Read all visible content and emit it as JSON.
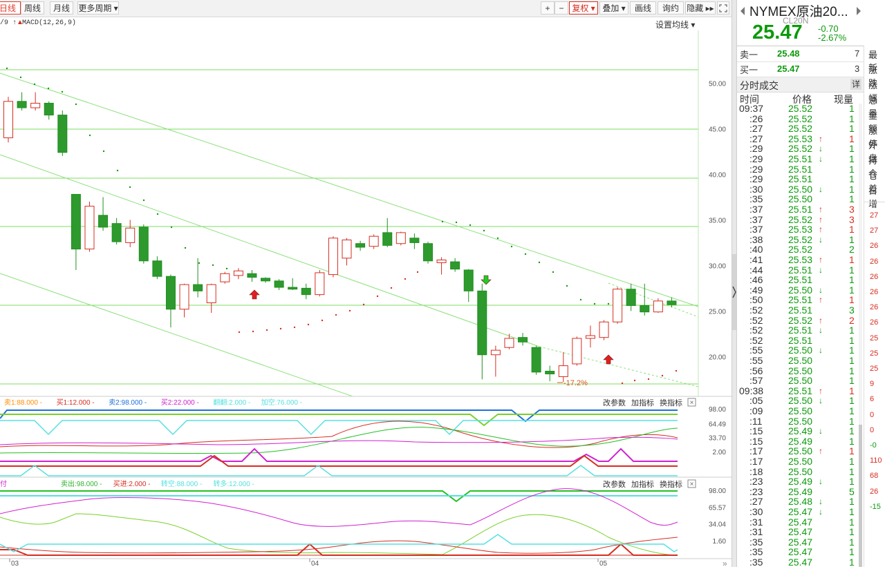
{
  "toolbar": {
    "tabs_left": [
      "日线",
      "周线",
      "月线",
      "更多周期 ▾"
    ],
    "tabs_right": [
      "+",
      "−",
      "复权 ▾",
      "叠加 ▾",
      "画线",
      "询约",
      "隐藏 ▸▸"
    ],
    "fullscreen_icon": "expand-icon"
  },
  "indicator_line": {
    "left": "/9 ↑ ",
    "macd": "MACD(12,26,9)",
    "setting": "设置均线 ▾"
  },
  "price_axis": [
    "50.00",
    "45.00",
    "40.00",
    "35.00",
    "30.00",
    "25.00",
    "20.00"
  ],
  "annotation": "-17.2%",
  "sub1": {
    "legend": [
      {
        "text": "卖1:88.000",
        "color": "#ff8c00"
      },
      {
        "text": "买1:12.000",
        "color": "#d62d20"
      },
      {
        "text": "卖2:98.000",
        "color": "#1e6fd9"
      },
      {
        "text": "买2:22.000",
        "color": "#d020d0"
      },
      {
        "text": "翻翻:2.000",
        "color": "#55e0e0"
      },
      {
        "text": "加空:76.000",
        "color": "#55e0e0"
      }
    ],
    "actions": [
      "改参数",
      "加指标",
      "换指标"
    ],
    "axis": [
      "98.00",
      "64.49",
      "33.70",
      "2.00"
    ]
  },
  "sub2": {
    "legend": [
      {
        "text": "卖出:98.000",
        "color": "#2db52d"
      },
      {
        "text": "买进:2.000",
        "color": "#d62d20"
      },
      {
        "text": "转空:88.000",
        "color": "#55e0e0"
      },
      {
        "text": "转多:12.000",
        "color": "#55e0e0"
      }
    ],
    "actions": [
      "改参数",
      "加指标",
      "换指标"
    ],
    "axis": [
      "98.00",
      "65.57",
      "34.04",
      "1.60"
    ]
  },
  "date_axis": [
    "03",
    "04",
    "05"
  ],
  "quote": {
    "name": "NYMEX原油20...",
    "code": "CL20N",
    "price": "25.47",
    "change": "-0.70",
    "change_pct": "-2.67%",
    "sell1_label": "卖一",
    "sell1_price": "25.48",
    "sell1_vol": "7",
    "buy1_label": "买一",
    "buy1_price": "25.47",
    "buy1_vol": "3"
  },
  "side_labels": [
    "最新",
    "涨跌",
    "涨幅",
    "总量",
    "金额",
    "涨停",
    "外盘",
    "持仓",
    "仓差",
    "日增"
  ],
  "side_values": [
    "27",
    "27",
    "26",
    "26",
    "26",
    "26",
    "26",
    "26",
    "25",
    "25",
    "25",
    "9",
    "6",
    "0",
    "0",
    "-0",
    "110",
    "68",
    "26",
    "-15"
  ],
  "ticks_header": {
    "title": "分时成交",
    "detail": "详",
    "col_time": "时间",
    "col_price": "价格",
    "col_vol": "现量"
  },
  "ticks": [
    [
      "09:37",
      "25.52",
      "",
      "1"
    ],
    [
      ":26",
      "25.52",
      "",
      "1"
    ],
    [
      ":27",
      "25.52",
      "",
      "1"
    ],
    [
      ":27",
      "25.53",
      "up",
      "1"
    ],
    [
      ":29",
      "25.52",
      "dn",
      "1"
    ],
    [
      ":29",
      "25.51",
      "dn",
      "1"
    ],
    [
      ":29",
      "25.51",
      "",
      "1"
    ],
    [
      ":29",
      "25.51",
      "",
      "1"
    ],
    [
      ":30",
      "25.50",
      "dn",
      "1"
    ],
    [
      ":35",
      "25.50",
      "",
      "1"
    ],
    [
      ":37",
      "25.51",
      "up",
      "3"
    ],
    [
      ":37",
      "25.52",
      "up",
      "3"
    ],
    [
      ":37",
      "25.53",
      "up",
      "1"
    ],
    [
      ":38",
      "25.52",
      "dn",
      "1"
    ],
    [
      ":40",
      "25.52",
      "",
      "2"
    ],
    [
      ":41",
      "25.53",
      "up",
      "1"
    ],
    [
      ":44",
      "25.51",
      "dn",
      "1"
    ],
    [
      ":46",
      "25.51",
      "",
      "1"
    ],
    [
      ":49",
      "25.50",
      "dn",
      "1"
    ],
    [
      ":50",
      "25.51",
      "up",
      "1"
    ],
    [
      ":52",
      "25.51",
      "",
      "3"
    ],
    [
      ":52",
      "25.52",
      "up",
      "2"
    ],
    [
      ":52",
      "25.51",
      "dn",
      "1"
    ],
    [
      ":52",
      "25.51",
      "",
      "1"
    ],
    [
      ":55",
      "25.50",
      "dn",
      "1"
    ],
    [
      ":55",
      "25.50",
      "",
      "1"
    ],
    [
      ":56",
      "25.50",
      "",
      "1"
    ],
    [
      ":57",
      "25.50",
      "",
      "1"
    ],
    [
      "09:38",
      "25.51",
      "up",
      "1"
    ],
    [
      ":05",
      "25.50",
      "dn",
      "1"
    ],
    [
      ":09",
      "25.50",
      "",
      "1"
    ],
    [
      ":11",
      "25.50",
      "",
      "1"
    ],
    [
      ":15",
      "25.49",
      "dn",
      "1"
    ],
    [
      ":15",
      "25.49",
      "",
      "1"
    ],
    [
      ":17",
      "25.50",
      "up",
      "1"
    ],
    [
      ":17",
      "25.50",
      "",
      "1"
    ],
    [
      ":18",
      "25.50",
      "",
      "1"
    ],
    [
      ":23",
      "25.49",
      "dn",
      "1"
    ],
    [
      ":23",
      "25.49",
      "",
      "5"
    ],
    [
      ":27",
      "25.48",
      "dn",
      "1"
    ],
    [
      ":30",
      "25.47",
      "dn",
      "1"
    ],
    [
      ":31",
      "25.47",
      "",
      "1"
    ],
    [
      ":31",
      "25.47",
      "",
      "1"
    ],
    [
      ":35",
      "25.47",
      "",
      "1"
    ],
    [
      ":35",
      "25.47",
      "",
      "1"
    ],
    [
      ":35",
      "25.47",
      "",
      "1"
    ]
  ],
  "chart_data": {
    "type": "candlestick",
    "y_range": [
      17,
      52
    ],
    "candles": [
      {
        "o": 44,
        "c": 48,
        "h": 48.5,
        "l": 43.5
      },
      {
        "o": 48,
        "c": 47.3,
        "h": 49,
        "l": 47
      },
      {
        "o": 47.3,
        "c": 47.8,
        "h": 49,
        "l": 47
      },
      {
        "o": 47.8,
        "c": 46.5,
        "h": 48,
        "l": 46
      },
      {
        "o": 46.5,
        "c": 42.4,
        "h": 47,
        "l": 42
      },
      {
        "o": 37.8,
        "c": 31.8,
        "h": 37.8,
        "l": 29.5
      },
      {
        "o": 31.8,
        "c": 36.5,
        "h": 37,
        "l": 31.5
      },
      {
        "o": 35.5,
        "c": 34.2,
        "h": 37.5,
        "l": 33.8
      },
      {
        "o": 34.6,
        "c": 32.6,
        "h": 35.2,
        "l": 32.3
      },
      {
        "o": 32.5,
        "c": 34.1,
        "h": 35,
        "l": 32
      },
      {
        "o": 34.2,
        "c": 30.5,
        "h": 34.5,
        "l": 30.2
      },
      {
        "o": 30.5,
        "c": 28.8,
        "h": 31,
        "l": 28.5
      },
      {
        "o": 28.8,
        "c": 25.2,
        "h": 29,
        "l": 23.2
      },
      {
        "o": 25.2,
        "c": 27.9,
        "h": 28,
        "l": 24.3
      },
      {
        "o": 27.9,
        "c": 27.2,
        "h": 30.8,
        "l": 26.5
      },
      {
        "o": 25.9,
        "c": 27.9,
        "h": 28,
        "l": 24.8
      },
      {
        "o": 28.2,
        "c": 29.1,
        "h": 29.3,
        "l": 28
      },
      {
        "o": 28.9,
        "c": 29.4,
        "h": 29.7,
        "l": 28.5
      },
      {
        "o": 29.1,
        "c": 28.7,
        "h": 29.5,
        "l": 28.2
      },
      {
        "o": 28.6,
        "c": 28.3,
        "h": 28.7,
        "l": 28.1
      },
      {
        "o": 28.3,
        "c": 27.6,
        "h": 28.5,
        "l": 27.3
      },
      {
        "o": 27.6,
        "c": 27.4,
        "h": 28.6,
        "l": 27.3
      },
      {
        "o": 27.5,
        "c": 26.8,
        "h": 28,
        "l": 26.3
      },
      {
        "o": 26.8,
        "c": 29.2,
        "h": 29.5,
        "l": 26.6
      },
      {
        "o": 29,
        "c": 33,
        "h": 33.2,
        "l": 28.7
      },
      {
        "o": 30.8,
        "c": 32.8,
        "h": 33,
        "l": 30
      },
      {
        "o": 32.4,
        "c": 32,
        "h": 32.7,
        "l": 31.6
      },
      {
        "o": 32.1,
        "c": 33.2,
        "h": 33.4,
        "l": 31.8
      },
      {
        "o": 33.6,
        "c": 32.2,
        "h": 35.2,
        "l": 32
      },
      {
        "o": 32.4,
        "c": 33.6,
        "h": 33.7,
        "l": 32.2
      },
      {
        "o": 33,
        "c": 32.5,
        "h": 33.5,
        "l": 31.8
      },
      {
        "o": 32.4,
        "c": 30.5,
        "h": 32.6,
        "l": 30.2
      },
      {
        "o": 30.3,
        "c": 30.6,
        "h": 30.9,
        "l": 29
      },
      {
        "o": 30.4,
        "c": 29.6,
        "h": 30.8,
        "l": 29.3
      },
      {
        "o": 29.5,
        "c": 27.2,
        "h": 29.6,
        "l": 26
      },
      {
        "o": 27.2,
        "c": 20.2,
        "h": 28,
        "l": 17.5
      },
      {
        "o": 20.2,
        "c": 20.7,
        "h": 21.2,
        "l": 17.8
      },
      {
        "o": 21,
        "c": 22,
        "h": 22.5,
        "l": 20.8
      },
      {
        "o": 22.1,
        "c": 21.6,
        "h": 22.6,
        "l": 21.2
      },
      {
        "o": 21,
        "c": 18.3,
        "h": 21.2,
        "l": 18
      },
      {
        "o": 18.4,
        "c": 18.1,
        "h": 19,
        "l": 17.3
      },
      {
        "o": 17.8,
        "c": 19,
        "h": 20.5,
        "l": 17.2
      },
      {
        "o": 19.2,
        "c": 22,
        "h": 22.2,
        "l": 19
      },
      {
        "o": 22,
        "c": 22.3,
        "h": 23.4,
        "l": 21
      },
      {
        "o": 22.1,
        "c": 23.8,
        "h": 24,
        "l": 21.8
      },
      {
        "o": 23.8,
        "c": 27.4,
        "h": 27.6,
        "l": 23.6
      },
      {
        "o": 27.4,
        "c": 25.6,
        "h": 28,
        "l": 25
      },
      {
        "o": 25.6,
        "c": 24.9,
        "h": 28,
        "l": 24.5
      },
      {
        "o": 24.9,
        "c": 26.1,
        "h": 26.4,
        "l": 24.8
      },
      {
        "o": 26.1,
        "c": 25.7,
        "h": 26.5,
        "l": 25.4
      }
    ]
  }
}
